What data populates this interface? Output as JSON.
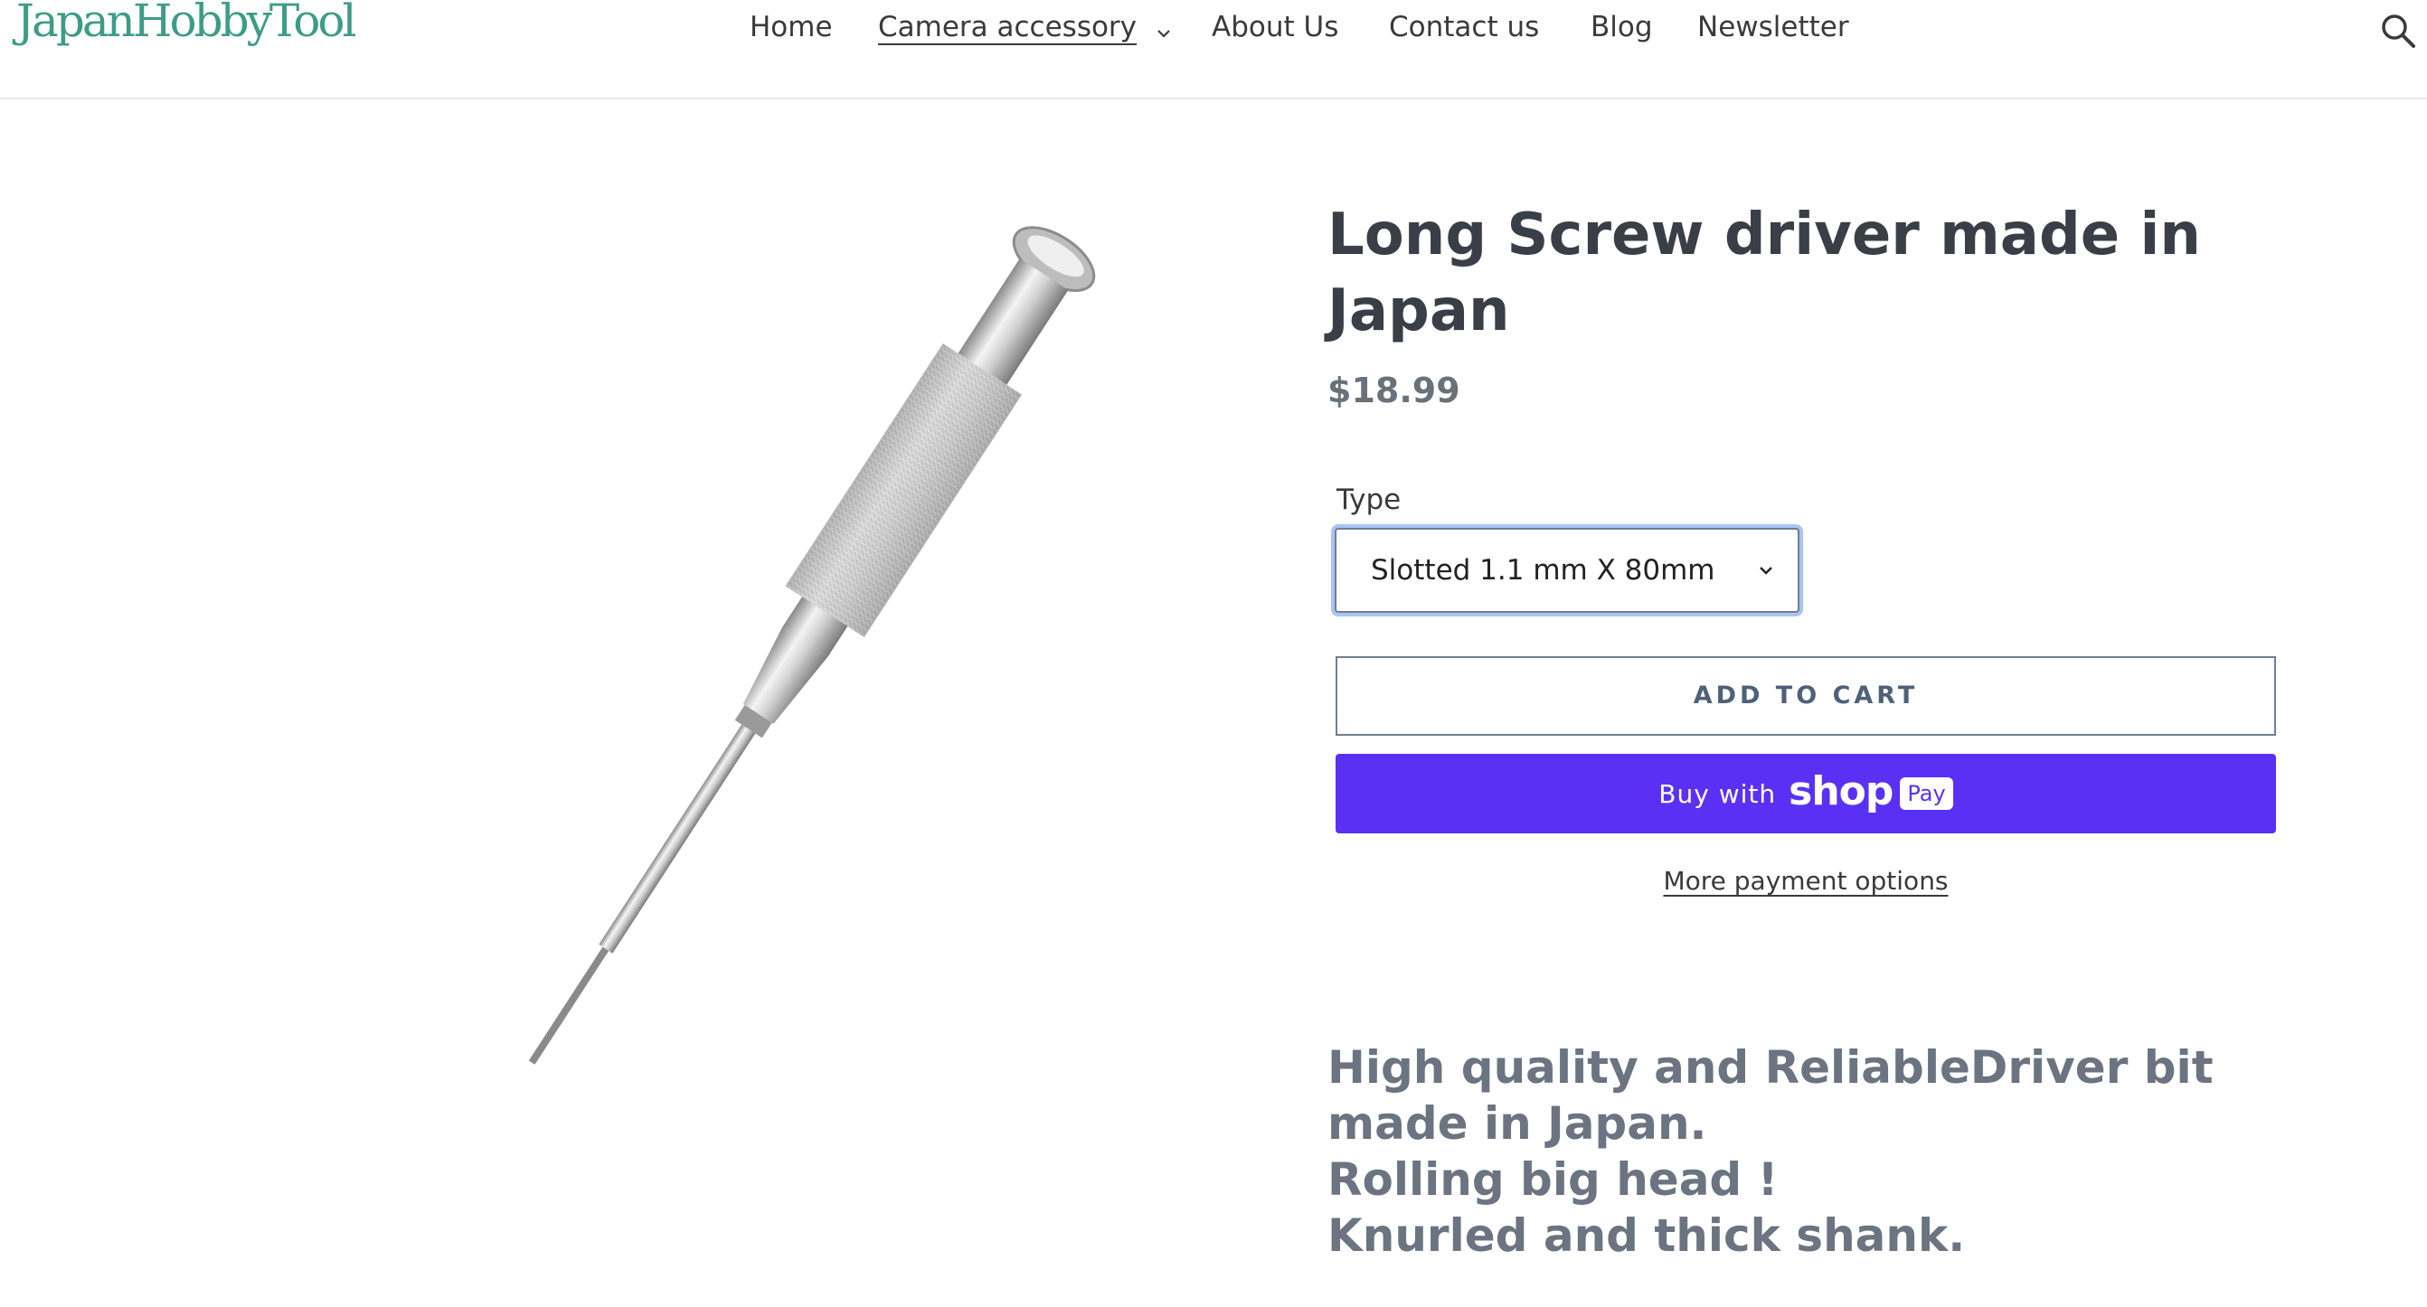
{
  "header": {
    "logo_text": "JapanHobbyTool",
    "nav": [
      {
        "label": "Home"
      },
      {
        "label": "Camera accessory",
        "has_dropdown": true,
        "active": true
      },
      {
        "label": "About Us"
      },
      {
        "label": "Contact us"
      },
      {
        "label": "Blog"
      },
      {
        "label": "Newsletter"
      }
    ],
    "search_icon": "search-icon"
  },
  "product": {
    "title": "Long Screw driver made in Japan",
    "price": "$18.99",
    "option_label": "Type",
    "option_selected": "Slotted 1.1 mm X 80mm",
    "add_to_cart_label": "ADD TO CART",
    "buy_with_label": "Buy with",
    "shop_label": "shop",
    "pay_label": "Pay",
    "more_payment_label": "More payment options",
    "description_lines": [
      "High quality and ReliableDriver bit made in Japan.",
      "Rolling big head !",
      "Knurled and thick shank."
    ]
  },
  "colors": {
    "brand": "#3e9c86",
    "shop_pay": "#5a31f4",
    "button_text": "#4e6179",
    "price": "#69727b"
  }
}
